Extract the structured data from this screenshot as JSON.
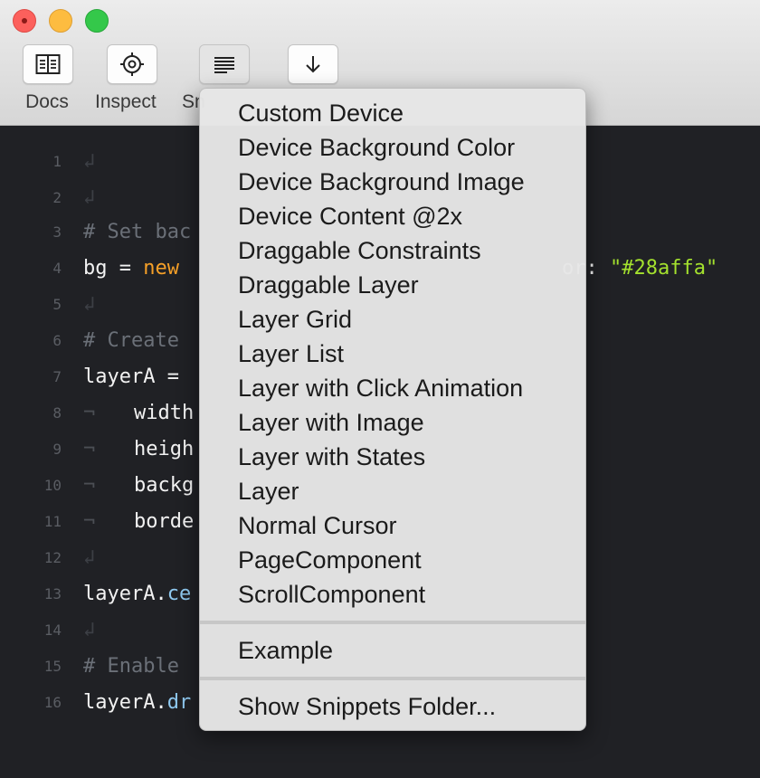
{
  "toolbar": {
    "docs_label": "Docs",
    "inspect_label": "Inspect",
    "snippets_label": "Sn",
    "docs_icon": "book-icon",
    "inspect_icon": "crosshair-icon",
    "snippets_icon": "lines-icon",
    "download_icon": "arrow-down-icon"
  },
  "editor": {
    "line_numbers": [
      "1",
      "2",
      "3",
      "4",
      "5",
      "6",
      "7",
      "8",
      "9",
      "10",
      "11",
      "12",
      "13",
      "14",
      "15",
      "16"
    ],
    "lines": {
      "l3_comment": "# Set bac",
      "l4_var": "bg",
      "l4_eq": " = ",
      "l4_new": "new",
      "l4_tail": "or: ",
      "l4_str": "\"#28affa\"",
      "l6_comment": "# Create",
      "l7_code": "layerA =",
      "l8_code": "width",
      "l9_code": "heigh",
      "l10_code": "backg",
      "l11_code": "borde",
      "l13_obj": "layerA.",
      "l13_prop": "ce",
      "l15_comment": "# Enable",
      "l16_obj": "layerA.",
      "l16_prop": "dr"
    },
    "return_glyph": "↲",
    "tab_glyph": "¬"
  },
  "menu": {
    "items": [
      "Custom Device",
      "Device Background Color",
      "Device Background Image",
      "Device Content @2x",
      "Draggable Constraints",
      "Draggable Layer",
      "Layer Grid",
      "Layer List",
      "Layer with Click Animation",
      "Layer with Image",
      "Layer with States",
      "Layer",
      "Normal Cursor",
      "PageComponent",
      "ScrollComponent"
    ],
    "example": "Example",
    "show_folder": "Show Snippets Folder..."
  },
  "colors": {
    "keyword": "#f6a028",
    "string": "#a4e12e",
    "property": "#8fc9f0",
    "comment": "#6b7078"
  }
}
